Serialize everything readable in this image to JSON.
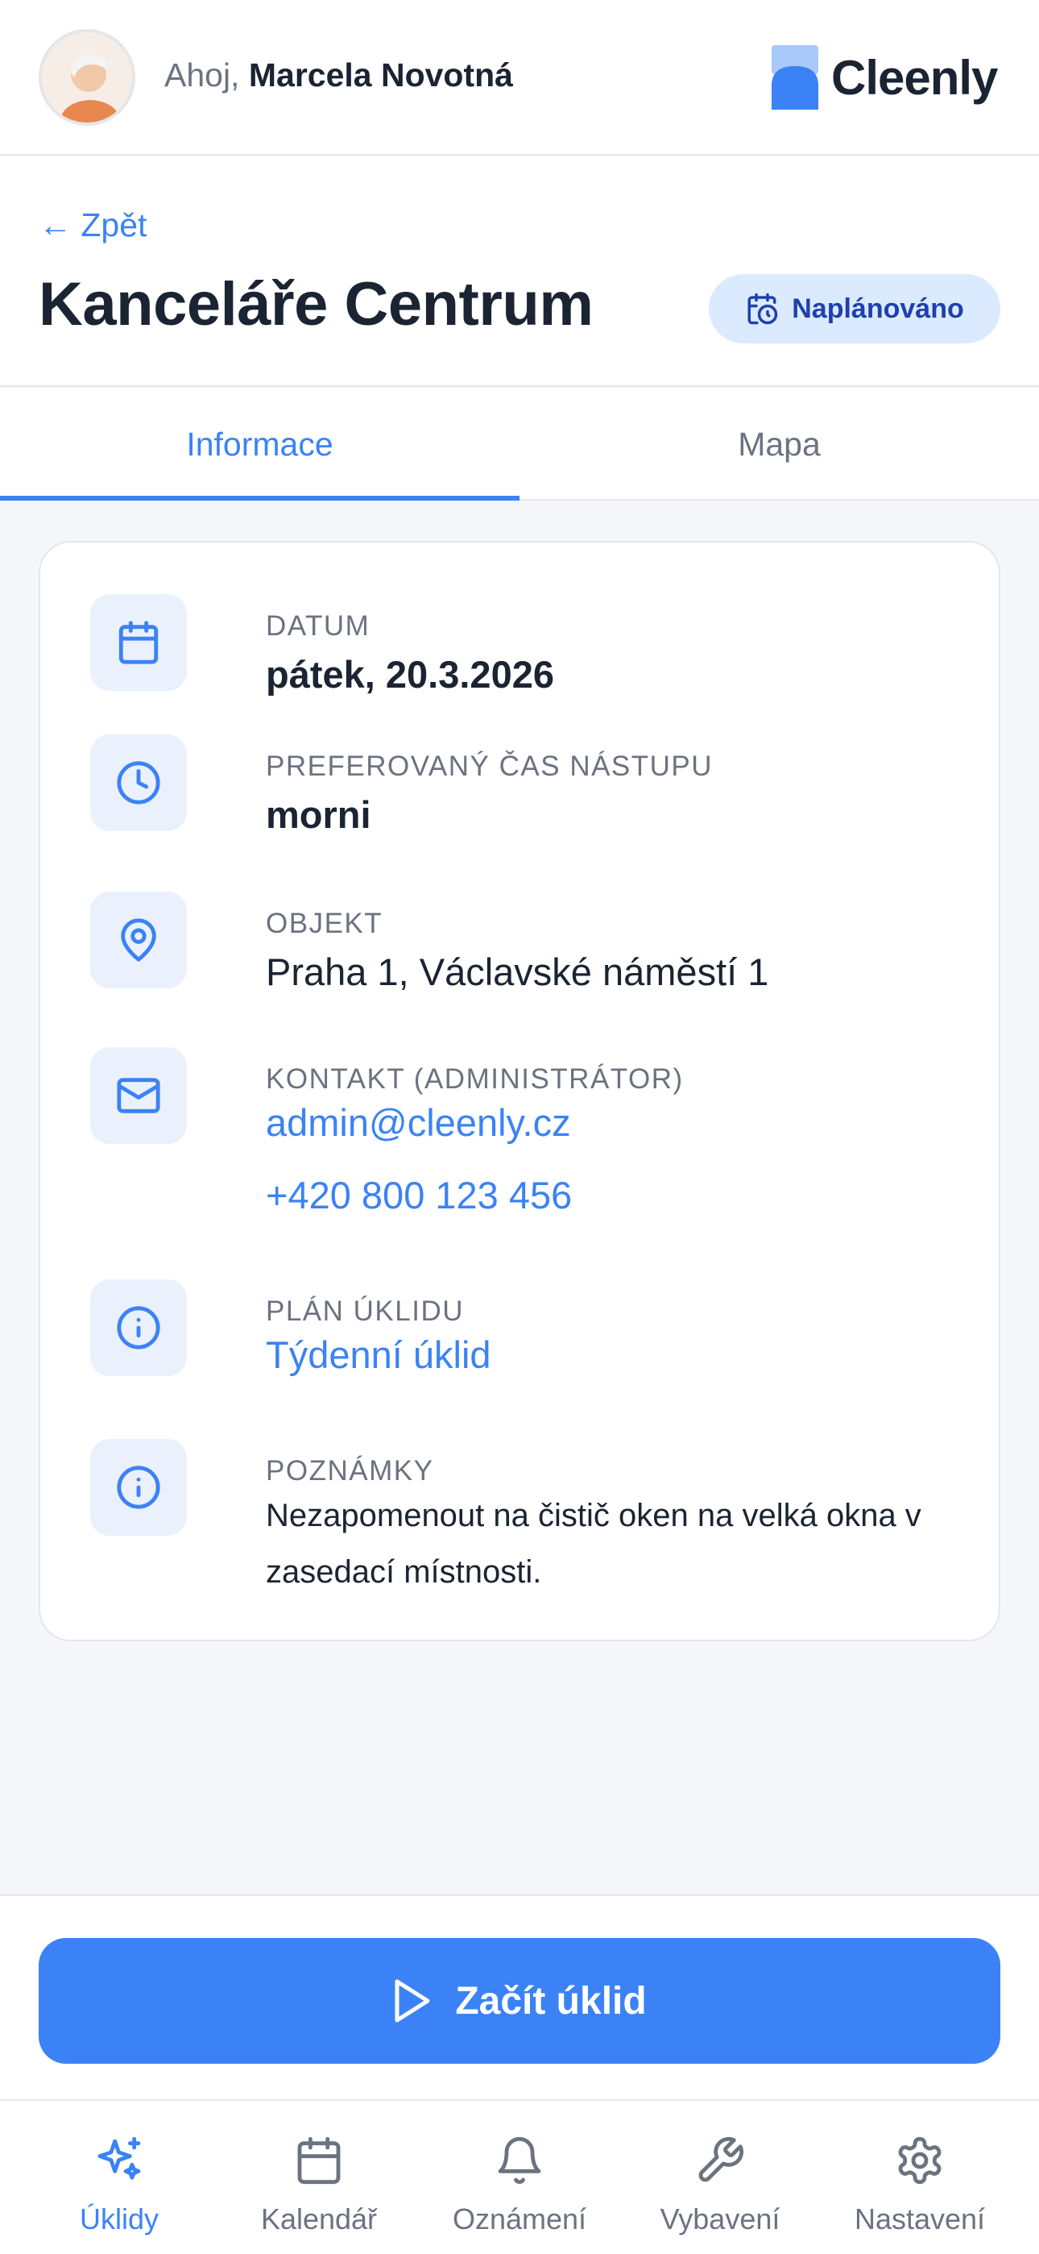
{
  "topbar": {
    "greeting_prefix": "Ahoj,",
    "user_name": "Marcela Novotná",
    "brand_name": "Cleenly"
  },
  "header": {
    "back_label": "← Zpět",
    "title": "Kanceláře Centrum",
    "status": "Naplánováno"
  },
  "tabs": [
    {
      "label": "Informace",
      "active": true
    },
    {
      "label": "Mapa",
      "active": false
    }
  ],
  "details": {
    "date": {
      "label": "DATUM",
      "value": "pátek, 20.3.2026",
      "icon": "calendar-icon"
    },
    "time": {
      "label": "PREFEROVANÝ ČAS NÁSTUPU",
      "value": "morni",
      "icon": "clock-icon"
    },
    "object": {
      "label": "OBJEKT",
      "value": "Praha 1, Václavské náměstí 1",
      "icon": "map-pin-icon"
    },
    "contact": {
      "label": "KONTAKT (ADMINISTRÁTOR)",
      "email": "admin@cleenly.cz",
      "phone": "+420 800 123 456",
      "icon": "mail-icon"
    },
    "plan": {
      "label": "PLÁN ÚKLIDU",
      "value": "Týdenní úklid",
      "icon": "info-icon"
    },
    "notes": {
      "label": "POZNÁMKY",
      "value": "Nezapomenout na čistič oken na velká okna v zasedací místnosti.",
      "icon": "info-icon"
    }
  },
  "action": {
    "start_label": "Začít úklid"
  },
  "nav": [
    {
      "label": "Úklidy",
      "icon": "sparkles-icon",
      "active": true
    },
    {
      "label": "Kalendář",
      "icon": "calendar-icon",
      "active": false
    },
    {
      "label": "Oznámení",
      "icon": "bell-icon",
      "active": false
    },
    {
      "label": "Vybavení",
      "icon": "wrench-icon",
      "active": false
    },
    {
      "label": "Nastavení",
      "icon": "gear-icon",
      "active": false
    }
  ],
  "colors": {
    "accent": "#3b82f6",
    "badge_bg": "#dbeafe",
    "badge_text": "#1e40af",
    "icon_box_bg": "#eaf1fd",
    "page_bg": "#f4f6f9"
  }
}
